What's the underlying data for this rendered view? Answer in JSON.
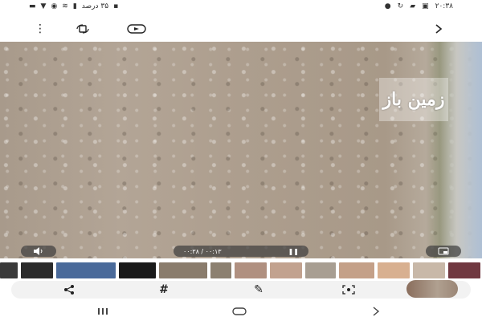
{
  "status_bar": {
    "time": "۲۰:۳۸",
    "battery_text": "۳۵ درصد",
    "icons": [
      "image-icon",
      "sync-icon",
      "chat-icon",
      "download-icon",
      "location-icon",
      "alarm-icon",
      "wifi-icon",
      "signal-icon",
      "battery-icon",
      "gallery-icon"
    ]
  },
  "toolbar": {
    "more_icon": "more-vert-icon",
    "rotate_icon": "rotate-icon",
    "cast_icon": "cast-icon",
    "back_icon": "chevron-icon"
  },
  "video": {
    "watermark_text": "زمین باز",
    "time_label": "۰۰:۳۸ / ۰۰:۱۳",
    "volume_icon": "volume-icon",
    "pause_icon": "pause-icon",
    "pip_icon": "pip-icon"
  },
  "filmstrip": {
    "thumbnails": [
      "#3a3a3a",
      "#2b2b2b",
      "#4a6a9a",
      "#1a1a1a",
      "#8a7c6c",
      "#8c8070",
      "#b09080",
      "#c2a28f",
      "#a89e92",
      "#c4a088",
      "#d8b090",
      "#c8b8a8",
      "#703840",
      "#556070"
    ]
  },
  "actions": {
    "share_icon": "share-icon",
    "hashtag_icon": "hashtag-icon",
    "edit_icon": "edit-icon",
    "capture_icon": "capture-icon"
  },
  "navbar": {
    "recents_icon": "recents-icon",
    "home_icon": "home-icon",
    "back_icon": "back-icon"
  }
}
